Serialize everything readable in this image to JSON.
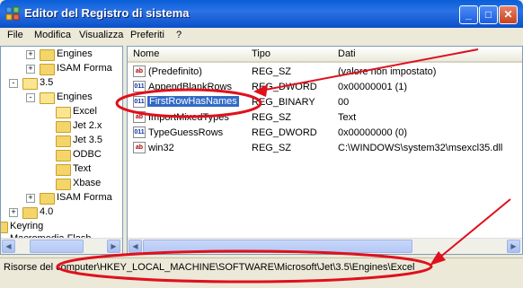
{
  "window": {
    "title": "Editor del Registro di sistema"
  },
  "titlebar_buttons": {
    "minimize": "_",
    "maximize": "□",
    "close": "✕"
  },
  "menu": [
    {
      "label": "File"
    },
    {
      "label": "Modifica"
    },
    {
      "label": "Visualizza"
    },
    {
      "label": "Preferiti"
    },
    {
      "label": "?"
    }
  ],
  "tree": {
    "items": [
      {
        "label": "Engines",
        "expander": "+"
      },
      {
        "label": "ISAM Forma",
        "expander": "+"
      },
      {
        "label": "3.5",
        "expander": "-"
      },
      {
        "label": "Engines",
        "expander": "-"
      },
      {
        "label": "Excel",
        "expander": ""
      },
      {
        "label": "Jet 2.x",
        "expander": ""
      },
      {
        "label": "Jet 3.5",
        "expander": ""
      },
      {
        "label": "ODBC",
        "expander": ""
      },
      {
        "label": "Text",
        "expander": ""
      },
      {
        "label": "Xbase",
        "expander": ""
      },
      {
        "label": "ISAM Forma",
        "expander": "+"
      },
      {
        "label": "4.0",
        "expander": "+"
      },
      {
        "label": "Keyring",
        "expander": ""
      },
      {
        "label": "Macromedia Flash",
        "expander": ""
      }
    ]
  },
  "table": {
    "columns": [
      "Nome",
      "Tipo",
      "Dati"
    ],
    "rows": [
      {
        "icon": "ab",
        "name": "(Predefinito)",
        "type": "REG_SZ",
        "data": "(valore non impostato)"
      },
      {
        "icon": "011",
        "name": "AppendBlankRows",
        "type": "REG_DWORD",
        "data": "0x00000001 (1)"
      },
      {
        "icon": "011",
        "name": "FirstRowHasNames",
        "type": "REG_BINARY",
        "data": "00"
      },
      {
        "icon": "ab",
        "name": "ImportMixedTypes",
        "type": "REG_SZ",
        "data": "Text"
      },
      {
        "icon": "011",
        "name": "TypeGuessRows",
        "type": "REG_DWORD",
        "data": "0x00000000 (0)"
      },
      {
        "icon": "ab",
        "name": "win32",
        "type": "REG_SZ",
        "data": "C:\\WINDOWS\\system32\\msexcl35.dll"
      }
    ],
    "selected_row": 2
  },
  "status": {
    "path": "Risorse del computer\\HKEY_LOCAL_MACHINE\\SOFTWARE\\Microsoft\\Jet\\3.5\\Engines\\Excel"
  },
  "colors": {
    "annotation": "#e0101c",
    "selection": "#316ac5",
    "title_bar": "#0a5fd8"
  }
}
